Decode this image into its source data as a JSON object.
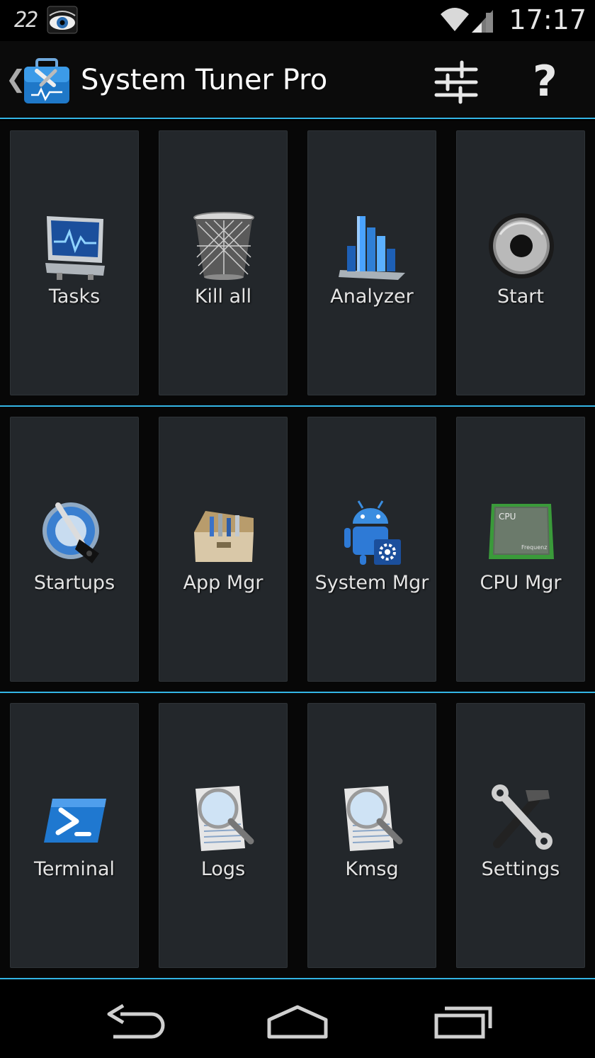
{
  "status_bar": {
    "battery_text": "22",
    "time": "17:17"
  },
  "action_bar": {
    "title": "System Tuner Pro"
  },
  "tiles": [
    {
      "label": "Tasks",
      "icon": "monitor-icon"
    },
    {
      "label": "Kill all",
      "icon": "trash-icon"
    },
    {
      "label": "Analyzer",
      "icon": "bar-chart-icon"
    },
    {
      "label": "Start",
      "icon": "start-button-icon"
    },
    {
      "label": "Startups",
      "icon": "startup-key-icon"
    },
    {
      "label": "App Mgr",
      "icon": "toolbox-icon"
    },
    {
      "label": "System Mgr",
      "icon": "android-gear-icon"
    },
    {
      "label": "CPU Mgr",
      "icon": "cpu-chip-icon"
    },
    {
      "label": "Terminal",
      "icon": "terminal-icon"
    },
    {
      "label": "Logs",
      "icon": "magnifier-document-icon"
    },
    {
      "label": "Kmsg",
      "icon": "magnifier-document-icon"
    },
    {
      "label": "Settings",
      "icon": "wrench-hammer-icon"
    }
  ],
  "cpu_chip_text": {
    "line1": "CPU",
    "line2": "Frequenz"
  },
  "colors": {
    "accent": "#33b5e5",
    "tile_bg": "#23272b",
    "background": "#070707"
  }
}
